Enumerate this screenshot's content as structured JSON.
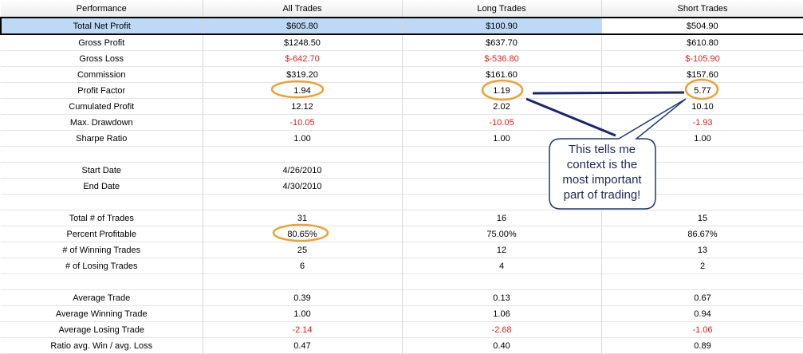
{
  "headers": [
    "Performance",
    "All Trades",
    "Long Trades",
    "Short Trades"
  ],
  "rows": [
    {
      "label": "Total Net Profit",
      "all": "$605.80",
      "long": "$100.90",
      "short": "$504.90",
      "neg": false,
      "highlight": true
    },
    {
      "label": "Gross Profit",
      "all": "$1248.50",
      "long": "$637.70",
      "short": "$610.80",
      "neg": false
    },
    {
      "label": "Gross Loss",
      "all": "$-642.70",
      "long": "$-536.80",
      "short": "$-105.90",
      "neg": true
    },
    {
      "label": "Commission",
      "all": "$319.20",
      "long": "$161.60",
      "short": "$157.60",
      "neg": false
    },
    {
      "label": "Profit Factor",
      "all": "1.94",
      "long": "1.19",
      "short": "5.77",
      "neg": false
    },
    {
      "label": "Cumulated Profit",
      "all": "12.12",
      "long": "2.02",
      "short": "10.10",
      "neg": false
    },
    {
      "label": "Max. Drawdown",
      "all": "-10.05",
      "long": "-10.05",
      "short": "-1.93",
      "neg": true
    },
    {
      "label": "Sharpe Ratio",
      "all": "1.00",
      "long": "1.00",
      "short": "1.00",
      "neg": false
    },
    {
      "label": "",
      "all": "",
      "long": "",
      "short": "",
      "neg": false
    },
    {
      "label": "Start Date",
      "all": "4/26/2010",
      "long": "",
      "short": "",
      "neg": false
    },
    {
      "label": "End Date",
      "all": "4/30/2010",
      "long": "",
      "short": "",
      "neg": false
    },
    {
      "label": "",
      "all": "",
      "long": "",
      "short": "",
      "neg": false
    },
    {
      "label": "Total # of Trades",
      "all": "31",
      "long": "16",
      "short": "15",
      "neg": false
    },
    {
      "label": "Percent Profitable",
      "all": "80.65%",
      "long": "75.00%",
      "short": "86.67%",
      "neg": false
    },
    {
      "label": "# of Winning Trades",
      "all": "25",
      "long": "12",
      "short": "13",
      "neg": false
    },
    {
      "label": "# of Losing Trades",
      "all": "6",
      "long": "4",
      "short": "2",
      "neg": false
    },
    {
      "label": "",
      "all": "",
      "long": "",
      "short": "",
      "neg": false
    },
    {
      "label": "Average Trade",
      "all": "0.39",
      "long": "0.13",
      "short": "0.67",
      "neg": false
    },
    {
      "label": "Average Winning Trade",
      "all": "1.00",
      "long": "1.06",
      "short": "0.94",
      "neg": false
    },
    {
      "label": "Average Losing Trade",
      "all": "-2.14",
      "long": "-2.68",
      "short": "-1.06",
      "neg": true
    },
    {
      "label": "Ratio avg. Win / avg. Loss",
      "all": "0.47",
      "long": "0.40",
      "short": "0.89",
      "neg": false
    }
  ],
  "annotation": {
    "lines": [
      "This tells me",
      "context is the",
      "most important",
      "part of trading!"
    ]
  },
  "colors": {
    "negative": "#e0201c",
    "highlight_row": "#bcd9f5",
    "circle": "#f0a030",
    "callout_line": "#1a2570"
  }
}
